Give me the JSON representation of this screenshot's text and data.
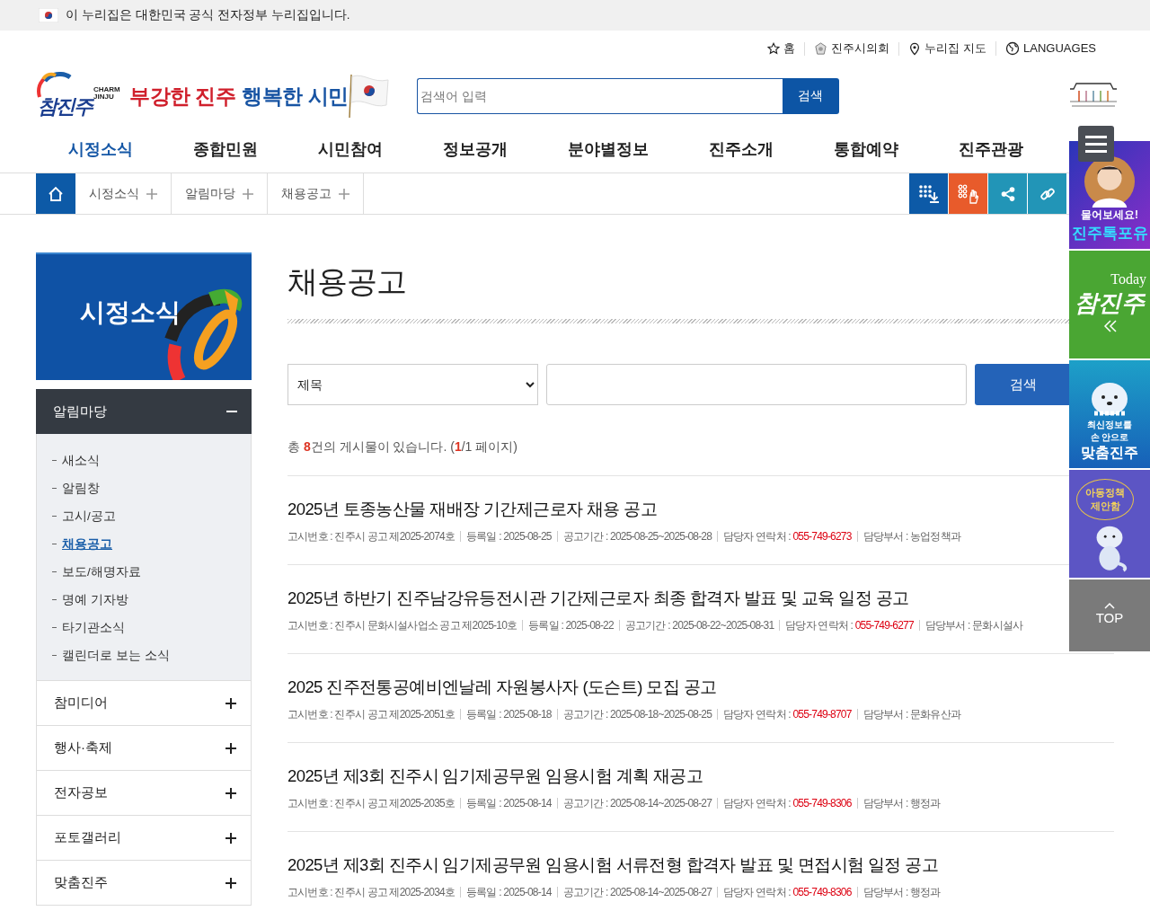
{
  "gov_banner": {
    "text": "이 누리집은 대한민국 공식 전자정부 누리집입니다."
  },
  "util_links": [
    {
      "kind": "home",
      "label": "홈"
    },
    {
      "kind": "council",
      "label": "진주시의회"
    },
    {
      "kind": "map",
      "label": "누리집 지도"
    },
    {
      "kind": "globe",
      "label": "LANGUAGES"
    }
  ],
  "logo": {
    "mark": "참진주",
    "sub": "CHARM JINJU"
  },
  "slogan": {
    "part_1": "부강한 진주",
    "part_2": "행복한 시민"
  },
  "header_search": {
    "placeholder": "검색어 입력",
    "button": "검색"
  },
  "gnb": [
    {
      "label": "시정소식",
      "selected": true
    },
    {
      "label": "종합민원",
      "selected": false
    },
    {
      "label": "시민참여",
      "selected": false
    },
    {
      "label": "정보공개",
      "selected": false
    },
    {
      "label": "분야별정보",
      "selected": false
    },
    {
      "label": "진주소개",
      "selected": false
    },
    {
      "label": "통합예약",
      "selected": false
    },
    {
      "label": "진주관광",
      "selected": false
    }
  ],
  "breadcrumb": [
    "시정소식",
    "알림마당",
    "채용공고"
  ],
  "tool_buttons": [
    {
      "kind": "download"
    },
    {
      "kind": "hand"
    },
    {
      "kind": "share"
    },
    {
      "kind": "link"
    }
  ],
  "sidebar": {
    "banner": "시정소식",
    "menu": [
      {
        "label": "알림마당",
        "expanded": true,
        "children": [
          {
            "label": "새소식",
            "selected": false
          },
          {
            "label": "알림창",
            "selected": false
          },
          {
            "label": "고시/공고",
            "selected": false
          },
          {
            "label": "채용공고",
            "selected": true
          },
          {
            "label": "보도/해명자료",
            "selected": false
          },
          {
            "label": "명예 기자방",
            "selected": false
          },
          {
            "label": "타기관소식",
            "selected": false
          },
          {
            "label": "캘린더로 보는 소식",
            "selected": false
          }
        ]
      },
      {
        "label": "참미디어",
        "expanded": false
      },
      {
        "label": "행사·축제",
        "expanded": false
      },
      {
        "label": "전자공보",
        "expanded": false
      },
      {
        "label": "포토갤러리",
        "expanded": false
      },
      {
        "label": "맞춤진주",
        "expanded": false
      }
    ]
  },
  "page_title": "채용공고",
  "board_search": {
    "field": "제목",
    "button": "검색"
  },
  "count": {
    "prefix": "총 ",
    "count": "8",
    "middle": "건의 게시물이 있습니다. (",
    "page": "1",
    "suffix": "/1 페이지)"
  },
  "posts": [
    {
      "title": "2025년 토종농산물 재배장 기간제근로자 채용 공고",
      "meta": [
        {
          "kind": "plain",
          "label": "고시번호 :",
          "value": "진주시 공고 제2025-2074호"
        },
        {
          "kind": "plain",
          "label": "등록일 :",
          "value": "2025-08-25"
        },
        {
          "kind": "plain",
          "label": "공고기간 :",
          "value": "2025-08-25~2025-08-28"
        },
        {
          "kind": "phone",
          "label": "담당자 연락처 :",
          "value": "055-749-6273"
        },
        {
          "kind": "plain",
          "label": "담당부서 :",
          "value": "농업정책과"
        }
      ]
    },
    {
      "title": "2025년 하반기 진주남강유등전시관 기간제근로자 최종 합격자 발표 및 교육 일정 공고",
      "meta": [
        {
          "kind": "plain",
          "label": "고시번호 :",
          "value": "진주시 문화시설사업소 공고 제2025-10호"
        },
        {
          "kind": "plain",
          "label": "등록일 :",
          "value": "2025-08-22"
        },
        {
          "kind": "plain",
          "label": "공고기간 :",
          "value": "2025-08-22~2025-08-31"
        },
        {
          "kind": "phone",
          "label": "담당자 연락처 :",
          "value": "055-749-6277"
        },
        {
          "kind": "plain",
          "label": "담당부서 :",
          "value": "문화시설사"
        }
      ]
    },
    {
      "title": "2025 진주전통공예비엔날레 자원봉사자 (도슨트) 모집 공고",
      "meta": [
        {
          "kind": "plain",
          "label": "고시번호 :",
          "value": "진주시 공고 제2025-2051호"
        },
        {
          "kind": "plain",
          "label": "등록일 :",
          "value": "2025-08-18"
        },
        {
          "kind": "plain",
          "label": "공고기간 :",
          "value": "2025-08-18~2025-08-25"
        },
        {
          "kind": "phone",
          "label": "담당자 연락처 :",
          "value": "055-749-8707"
        },
        {
          "kind": "plain",
          "label": "담당부서 :",
          "value": "문화유산과"
        }
      ]
    },
    {
      "title": "2025년 제3회 진주시 임기제공무원 임용시험 계획 재공고",
      "meta": [
        {
          "kind": "plain",
          "label": "고시번호 :",
          "value": "진주시 공고 제2025-2035호"
        },
        {
          "kind": "plain",
          "label": "등록일 :",
          "value": "2025-08-14"
        },
        {
          "kind": "plain",
          "label": "공고기간 :",
          "value": "2025-08-14~2025-08-27"
        },
        {
          "kind": "phone",
          "label": "담당자 연락처 :",
          "value": "055-749-8306"
        },
        {
          "kind": "plain",
          "label": "담당부서 :",
          "value": "행정과"
        }
      ]
    },
    {
      "title": "2025년 제3회 진주시 임기제공무원 임용시험 서류전형 합격자 발표 및 면접시험 일정 공고",
      "meta": [
        {
          "kind": "plain",
          "label": "고시번호 :",
          "value": "진주시 공고 제2025-2034호"
        },
        {
          "kind": "plain",
          "label": "등록일 :",
          "value": "2025-08-14"
        },
        {
          "kind": "plain",
          "label": "공고기간 :",
          "value": "2025-08-14~2025-08-27"
        },
        {
          "kind": "phone",
          "label": "담당자 연락처 :",
          "value": "055-749-8306"
        },
        {
          "kind": "plain",
          "label": "담당부서 :",
          "value": "행정과"
        }
      ]
    }
  ],
  "quick_menu": [
    {
      "kind": "talk",
      "lines": [
        "물어보세요!",
        "진주톡포유"
      ]
    },
    {
      "kind": "today",
      "lines": [
        "Today",
        "참진주"
      ]
    },
    {
      "kind": "app",
      "lines": [
        "최신정보를",
        "손 안으로",
        "맞춤진주"
      ]
    },
    {
      "kind": "proposal",
      "lines": [
        "아동정책",
        "제안함"
      ]
    },
    {
      "kind": "top",
      "lines": [
        "TOP"
      ]
    }
  ]
}
